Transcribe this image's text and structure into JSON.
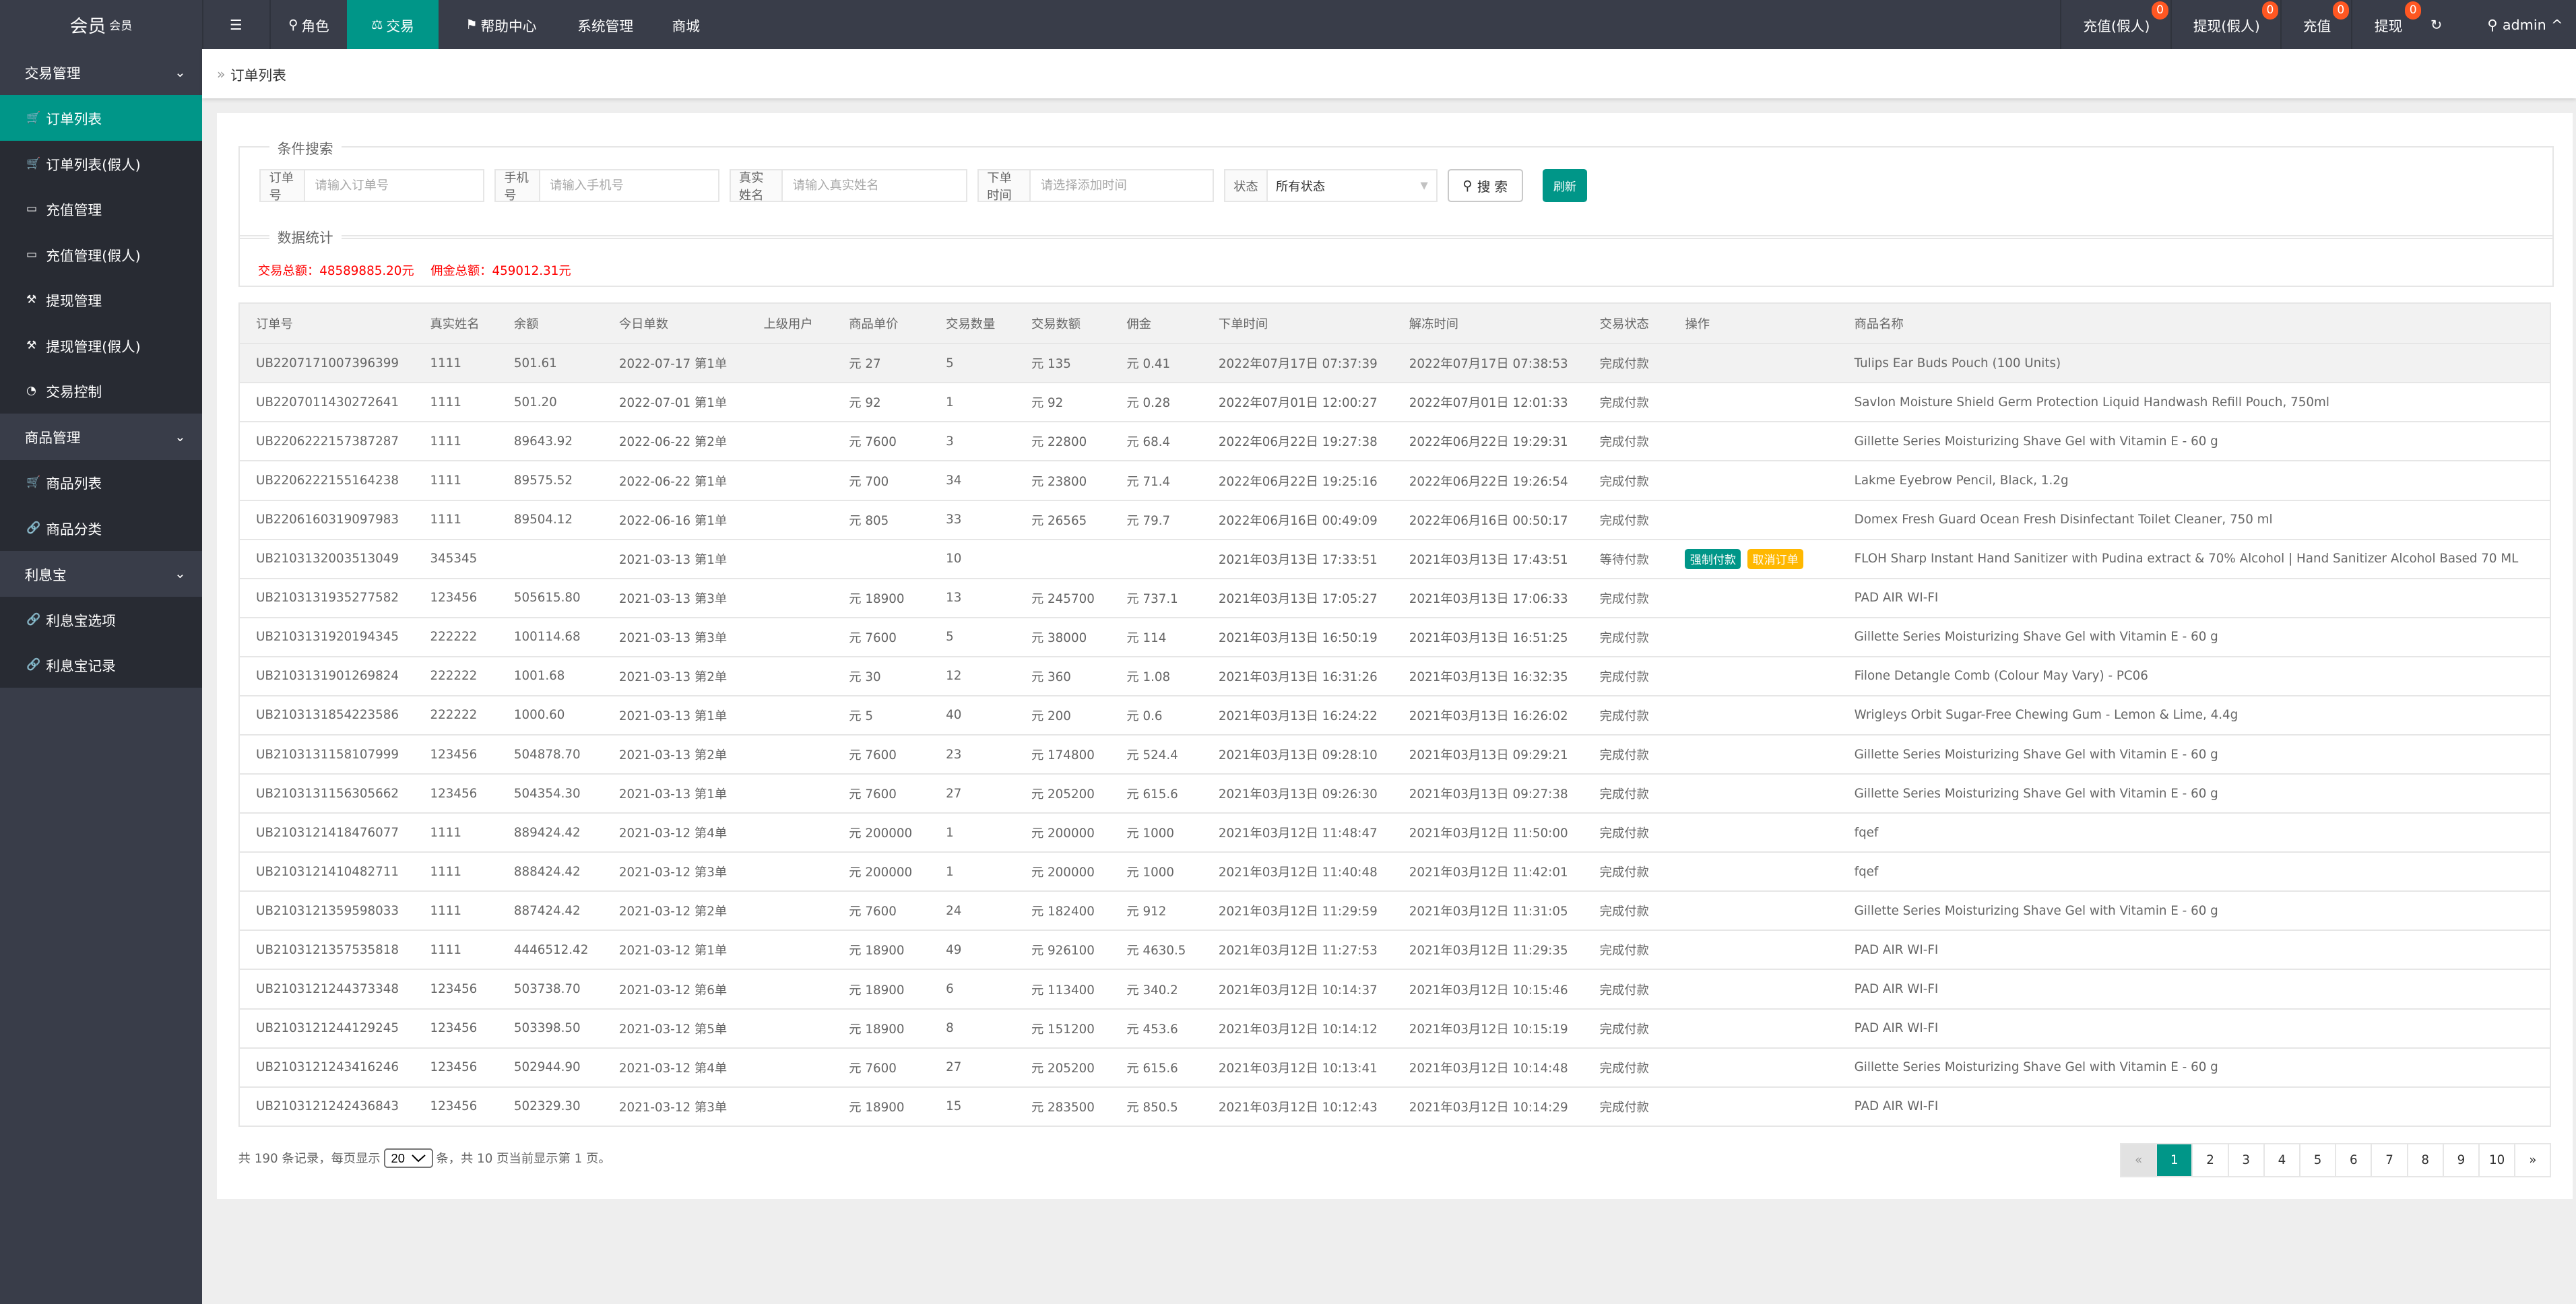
{
  "colors": {
    "accent": "#009688",
    "topbar": "#393D49",
    "badge": "#FF5722",
    "warn": "#FFB800",
    "stats": "#FF0000"
  },
  "logo": {
    "title": "会员",
    "sup": "会员"
  },
  "topnav": [
    {
      "label": "角色",
      "icon": "user-icon"
    },
    {
      "label": "交易",
      "icon": "scale-icon",
      "active": true
    },
    {
      "label": "帮助中心",
      "icon": "flag-icon"
    },
    {
      "label": "系统管理"
    },
    {
      "label": "商城"
    }
  ],
  "rightnav": [
    {
      "label": "充值(假人)",
      "badge": "0"
    },
    {
      "label": "提现(假人)",
      "badge": "0"
    },
    {
      "label": "充值",
      "badge": "0"
    },
    {
      "label": "提现",
      "badge": "0"
    }
  ],
  "user": {
    "name": "admin"
  },
  "sidebar": {
    "groups": [
      {
        "label": "交易管理",
        "items": [
          {
            "label": "订单列表",
            "icon": "cart-icon",
            "active": true
          },
          {
            "label": "订单列表(假人)",
            "icon": "cart-icon"
          },
          {
            "label": "充值管理",
            "icon": "presentation-icon"
          },
          {
            "label": "充值管理(假人)",
            "icon": "presentation-icon"
          },
          {
            "label": "提现管理",
            "icon": "hammer-icon"
          },
          {
            "label": "提现管理(假人)",
            "icon": "hammer-icon"
          },
          {
            "label": "交易控制",
            "icon": "gauge-icon"
          }
        ]
      },
      {
        "label": "商品管理",
        "items": [
          {
            "label": "商品列表",
            "icon": "cart-icon"
          },
          {
            "label": "商品分类",
            "icon": "link-icon"
          }
        ]
      },
      {
        "label": "利息宝",
        "items": [
          {
            "label": "利息宝选项",
            "icon": "link-icon"
          },
          {
            "label": "利息宝记录",
            "icon": "link-icon"
          }
        ]
      }
    ]
  },
  "breadcrumb": "订单列表",
  "search": {
    "legend": "条件搜索",
    "order_label": "订单号",
    "order_placeholder": "请输入订单号",
    "order_value": "",
    "phone_label": "手机号",
    "phone_placeholder": "请输入手机号",
    "phone_value": "",
    "name_label": "真实姓名",
    "name_placeholder": "请输入真实姓名",
    "name_value": "",
    "time_label": "下单时间",
    "time_placeholder": "请选择添加时间",
    "time_value": "",
    "status_label": "状态",
    "status_value": "所有状态",
    "search_button": "搜 索",
    "refresh_button": "刷新"
  },
  "stats": {
    "legend": "数据统计",
    "total_trade": "交易总额：48589885.20元",
    "total_commission": "佣金总额：459012.31元"
  },
  "table": {
    "headers": [
      "订单号",
      "真实姓名",
      "余额",
      "今日单数",
      "上级用户",
      "商品单价",
      "交易数量",
      "交易数额",
      "佣金",
      "下单时间",
      "解冻时间",
      "交易状态",
      "操作",
      "商品名称"
    ],
    "action_labels": {
      "force_pay": "强制付款",
      "cancel": "取消订单"
    },
    "rows": [
      [
        "UB2207171007396399",
        "1111",
        "501.61",
        "2022-07-17 第1单",
        "",
        "元 27",
        "5",
        "元 135",
        "元 0.41",
        "2022年07月17日 07:37:39",
        "2022年07月17日 07:38:53",
        "完成付款",
        "",
        "Tulips Ear Buds Pouch (100 Units)"
      ],
      [
        "UB2207011430272641",
        "1111",
        "501.20",
        "2022-07-01 第1单",
        "",
        "元 92",
        "1",
        "元 92",
        "元 0.28",
        "2022年07月01日 12:00:27",
        "2022年07月01日 12:01:33",
        "完成付款",
        "",
        "Savlon Moisture Shield Germ Protection Liquid Handwash Refill Pouch, 750ml"
      ],
      [
        "UB2206222157387287",
        "1111",
        "89643.92",
        "2022-06-22 第2单",
        "",
        "元 7600",
        "3",
        "元 22800",
        "元 68.4",
        "2022年06月22日 19:27:38",
        "2022年06月22日 19:29:31",
        "完成付款",
        "",
        "Gillette Series Moisturizing Shave Gel with Vitamin E - 60 g"
      ],
      [
        "UB2206222155164238",
        "1111",
        "89575.52",
        "2022-06-22 第1单",
        "",
        "元 700",
        "34",
        "元 23800",
        "元 71.4",
        "2022年06月22日 19:25:16",
        "2022年06月22日 19:26:54",
        "完成付款",
        "",
        "Lakme Eyebrow Pencil, Black, 1.2g"
      ],
      [
        "UB2206160319097983",
        "1111",
        "89504.12",
        "2022-06-16 第1单",
        "",
        "元 805",
        "33",
        "元 26565",
        "元 79.7",
        "2022年06月16日 00:49:09",
        "2022年06月16日 00:50:17",
        "完成付款",
        "",
        "Domex Fresh Guard Ocean Fresh Disinfectant Toilet Cleaner, 750 ml"
      ],
      [
        "UB2103132003513049",
        "345345",
        "",
        "2021-03-13 第1单",
        "",
        "",
        "10",
        "",
        "",
        "2021年03月13日 17:33:51",
        "2021年03月13日 17:43:51",
        "等待付款",
        "actions",
        "FLOH Sharp Instant Hand Sanitizer with Pudina extract & 70% Alcohol | Hand Sanitizer Alcohol Based 70 ML"
      ],
      [
        "UB2103131935277582",
        "123456",
        "505615.80",
        "2021-03-13 第3单",
        "",
        "元 18900",
        "13",
        "元 245700",
        "元 737.1",
        "2021年03月13日 17:05:27",
        "2021年03月13日 17:06:33",
        "完成付款",
        "",
        "PAD AIR WI-FI"
      ],
      [
        "UB2103131920194345",
        "222222",
        "100114.68",
        "2021-03-13 第3单",
        "",
        "元 7600",
        "5",
        "元 38000",
        "元 114",
        "2021年03月13日 16:50:19",
        "2021年03月13日 16:51:25",
        "完成付款",
        "",
        "Gillette Series Moisturizing Shave Gel with Vitamin E - 60 g"
      ],
      [
        "UB2103131901269824",
        "222222",
        "1001.68",
        "2021-03-13 第2单",
        "",
        "元 30",
        "12",
        "元 360",
        "元 1.08",
        "2021年03月13日 16:31:26",
        "2021年03月13日 16:32:35",
        "完成付款",
        "",
        "Filone Detangle Comb (Colour May Vary) - PC06"
      ],
      [
        "UB2103131854223586",
        "222222",
        "1000.60",
        "2021-03-13 第1单",
        "",
        "元 5",
        "40",
        "元 200",
        "元 0.6",
        "2021年03月13日 16:24:22",
        "2021年03月13日 16:26:02",
        "完成付款",
        "",
        "Wrigleys Orbit Sugar-Free Chewing Gum - Lemon & Lime, 4.4g"
      ],
      [
        "UB2103131158107999",
        "123456",
        "504878.70",
        "2021-03-13 第2单",
        "",
        "元 7600",
        "23",
        "元 174800",
        "元 524.4",
        "2021年03月13日 09:28:10",
        "2021年03月13日 09:29:21",
        "完成付款",
        "",
        "Gillette Series Moisturizing Shave Gel with Vitamin E - 60 g"
      ],
      [
        "UB2103131156305662",
        "123456",
        "504354.30",
        "2021-03-13 第1单",
        "",
        "元 7600",
        "27",
        "元 205200",
        "元 615.6",
        "2021年03月13日 09:26:30",
        "2021年03月13日 09:27:38",
        "完成付款",
        "",
        "Gillette Series Moisturizing Shave Gel with Vitamin E - 60 g"
      ],
      [
        "UB2103121418476077",
        "1111",
        "889424.42",
        "2021-03-12 第4单",
        "",
        "元 200000",
        "1",
        "元 200000",
        "元 1000",
        "2021年03月12日 11:48:47",
        "2021年03月12日 11:50:00",
        "完成付款",
        "",
        "fqef"
      ],
      [
        "UB2103121410482711",
        "1111",
        "888424.42",
        "2021-03-12 第3单",
        "",
        "元 200000",
        "1",
        "元 200000",
        "元 1000",
        "2021年03月12日 11:40:48",
        "2021年03月12日 11:42:01",
        "完成付款",
        "",
        "fqef"
      ],
      [
        "UB2103121359598033",
        "1111",
        "887424.42",
        "2021-03-12 第2单",
        "",
        "元 7600",
        "24",
        "元 182400",
        "元 912",
        "2021年03月12日 11:29:59",
        "2021年03月12日 11:31:05",
        "完成付款",
        "",
        "Gillette Series Moisturizing Shave Gel with Vitamin E - 60 g"
      ],
      [
        "UB2103121357535818",
        "1111",
        "4446512.42",
        "2021-03-12 第1单",
        "",
        "元 18900",
        "49",
        "元 926100",
        "元 4630.5",
        "2021年03月12日 11:27:53",
        "2021年03月12日 11:29:35",
        "完成付款",
        "",
        "PAD AIR WI-FI"
      ],
      [
        "UB2103121244373348",
        "123456",
        "503738.70",
        "2021-03-12 第6单",
        "",
        "元 18900",
        "6",
        "元 113400",
        "元 340.2",
        "2021年03月12日 10:14:37",
        "2021年03月12日 10:15:46",
        "完成付款",
        "",
        "PAD AIR WI-FI"
      ],
      [
        "UB2103121244129245",
        "123456",
        "503398.50",
        "2021-03-12 第5单",
        "",
        "元 18900",
        "8",
        "元 151200",
        "元 453.6",
        "2021年03月12日 10:14:12",
        "2021年03月12日 10:15:19",
        "完成付款",
        "",
        "PAD AIR WI-FI"
      ],
      [
        "UB2103121243416246",
        "123456",
        "502944.90",
        "2021-03-12 第4单",
        "",
        "元 7600",
        "27",
        "元 205200",
        "元 615.6",
        "2021年03月12日 10:13:41",
        "2021年03月12日 10:14:48",
        "完成付款",
        "",
        "Gillette Series Moisturizing Shave Gel with Vitamin E - 60 g"
      ],
      [
        "UB2103121242436843",
        "123456",
        "502329.30",
        "2021-03-12 第3单",
        "",
        "元 18900",
        "15",
        "元 283500",
        "元 850.5",
        "2021年03月12日 10:12:43",
        "2021年03月12日 10:14:29",
        "完成付款",
        "",
        "PAD AIR WI-FI"
      ]
    ]
  },
  "footer": {
    "prefix": "共 190 条记录，每页显示",
    "page_size": "20",
    "suffix": "条，共 10 页当前显示第 1 页。"
  },
  "pagination": {
    "prev": "«",
    "next": "»",
    "pages": [
      "1",
      "2",
      "3",
      "4",
      "5",
      "6",
      "7",
      "8",
      "9",
      "10"
    ],
    "current": "1"
  }
}
